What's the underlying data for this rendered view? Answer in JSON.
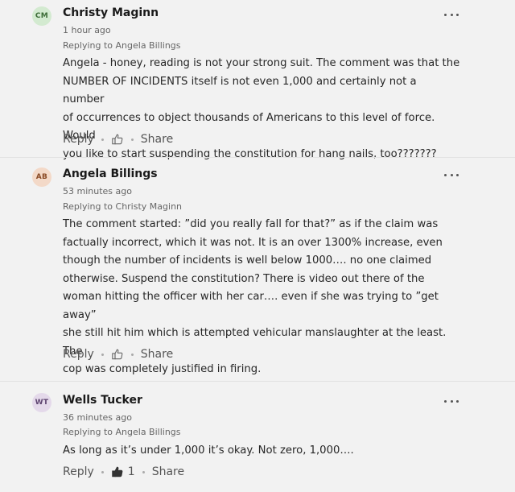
{
  "comments": [
    {
      "initials": "CM",
      "avatar_bg": "#d3ead0",
      "avatar_fg": "#3b6b36",
      "name": "Christy Maginn",
      "time": "1 hour ago",
      "reply_to": "Replying to Angela Billings",
      "lines": [
        "Angela - honey, reading is not your strong suit. The comment was that the",
        "NUMBER OF INCIDENTS itself is not even 1,000 and certainly not a number",
        "of occurrences to object thousands of Americans to this level of force. Would",
        "you like to start suspending the constitution for hang nails, too???????"
      ],
      "reply_label": "Reply",
      "share_label": "Share",
      "like_count": "",
      "liked": false
    },
    {
      "initials": "AB",
      "avatar_bg": "#f3d9c8",
      "avatar_fg": "#8a4b26",
      "name": "Angela Billings",
      "time": "53 minutes ago",
      "reply_to": "Replying to Christy Maginn",
      "lines": [
        "The comment started: ”did you really fall for that?” as if the claim was",
        "factually incorrect, which it was not.  It is an over 1300% increase, even",
        "though the number of incidents is well below 1000…. no one claimed",
        "otherwise.  Suspend the constitution?  There is video out there of the",
        "woman hitting the officer with her car….  even if she was trying to ”get away”",
        "she still hit him which is attempted vehicular manslaughter at the least.  The",
        "cop was completely justified in firing."
      ],
      "reply_label": "Reply",
      "share_label": "Share",
      "like_count": "",
      "liked": false
    },
    {
      "initials": "WT",
      "avatar_bg": "#e4d9ea",
      "avatar_fg": "#5e4470",
      "name": "Wells Tucker",
      "time": "36 minutes ago",
      "reply_to": "Replying to Angela Billings",
      "lines": [
        "As long as it’s under 1,000 it’s okay. Not zero, 1,000…."
      ],
      "reply_label": "Reply",
      "share_label": "Share",
      "like_count": "1",
      "liked": true
    }
  ]
}
